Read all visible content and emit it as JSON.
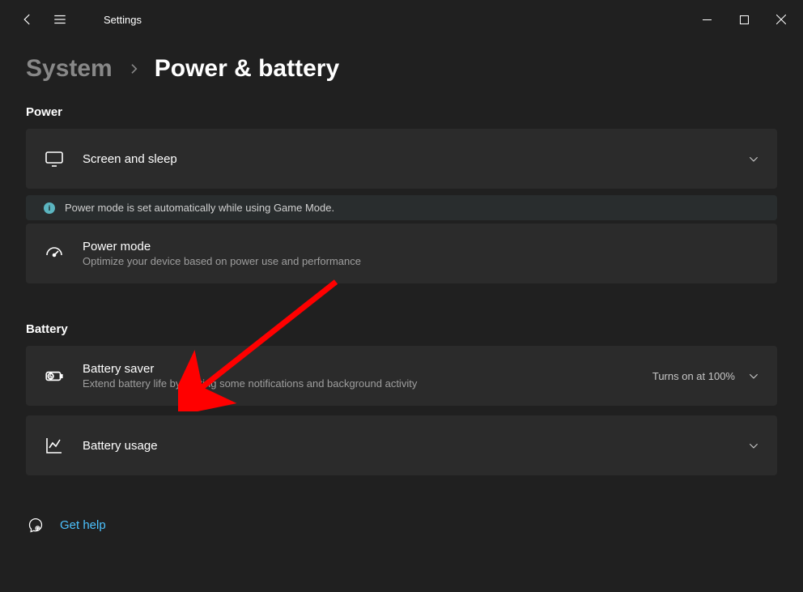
{
  "app": {
    "title": "Settings"
  },
  "breadcrumb": {
    "parent": "System",
    "current": "Power & battery"
  },
  "sections": {
    "power": {
      "header": "Power",
      "screen_sleep": {
        "title": "Screen and sleep"
      },
      "info_banner": "Power mode is set automatically while using Game Mode.",
      "power_mode": {
        "title": "Power mode",
        "sub": "Optimize your device based on power use and performance"
      }
    },
    "battery": {
      "header": "Battery",
      "battery_saver": {
        "title": "Battery saver",
        "sub": "Extend battery life by limiting some notifications and background activity",
        "value": "Turns on at 100%"
      },
      "battery_usage": {
        "title": "Battery usage"
      }
    }
  },
  "help": {
    "label": "Get help"
  }
}
